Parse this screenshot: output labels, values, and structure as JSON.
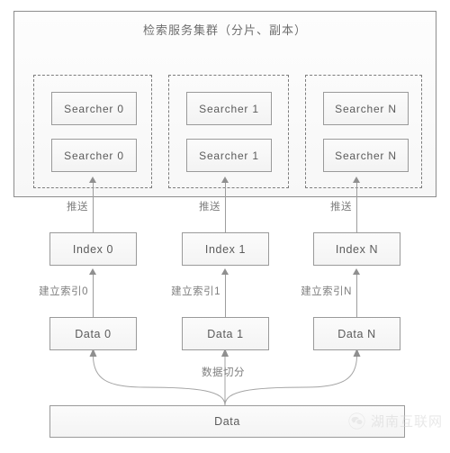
{
  "diagram": {
    "title": "检索服务集群（分片、副本）",
    "cluster": {
      "label": "检索服务集群（分片、副本）",
      "shards": [
        {
          "primary": "Searcher 0",
          "replica": "Searcher 0"
        },
        {
          "primary": "Searcher 1",
          "replica": "Searcher 1"
        },
        {
          "primary": "Searcher N",
          "replica": "Searcher N"
        }
      ]
    },
    "index_row": [
      {
        "label": "Index 0"
      },
      {
        "label": "Index 1"
      },
      {
        "label": "Index N"
      }
    ],
    "data_row": [
      {
        "label": "Data 0"
      },
      {
        "label": "Data 1"
      },
      {
        "label": "Data N"
      }
    ],
    "source": {
      "label": "Data"
    },
    "edges": {
      "push": [
        "推送",
        "推送",
        "推送"
      ],
      "build_index": [
        "建立索引0",
        "建立索引1",
        "建立索引N"
      ],
      "split": "数据切分"
    }
  },
  "watermark": {
    "text": "湖南互联网",
    "icon": "wechat-icon"
  },
  "colors": {
    "box_border": "#9a9a9a",
    "box_fill": "#f8f8f8",
    "text": "#5b5b5b",
    "label_text": "#7d7d7d",
    "dashed_border": "#7d7d7d",
    "connector": "#9d9d9d",
    "watermark": "#d3d3d3",
    "background": "#ffffff"
  }
}
